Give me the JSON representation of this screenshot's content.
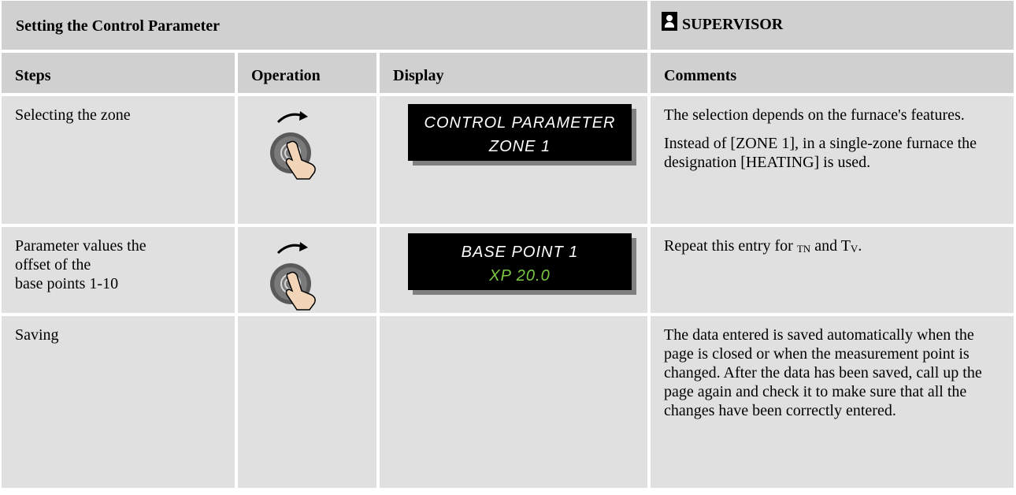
{
  "header": {
    "title": "Setting the Control Parameter",
    "role_label": "SUPERVISOR",
    "role_icon": "user-icon"
  },
  "columns": {
    "steps": "Steps",
    "operation": "Operation",
    "display": "Display",
    "comments": "Comments"
  },
  "rows": [
    {
      "step": "Selecting the zone",
      "operation_icon": "rotary-knob-icon",
      "display": {
        "line1": "CONTROL PARAMETER",
        "line2": "ZONE 1"
      },
      "comments": [
        "The selection depends on the furnace's features.",
        "Instead of [ZONE 1], in a single-zone furnace the designation [HEATING] is used."
      ]
    },
    {
      "step_lines": [
        "Parameter values the",
        "offset of the",
        "base points 1-10"
      ],
      "operation_icon": "rotary-knob-icon",
      "display": {
        "line1": "BASE POINT 1",
        "line2": "XP 20.0"
      },
      "comment_prefix": "Repeat this entry for ",
      "comment_sub1": "TN",
      "comment_mid": " and T",
      "comment_sub2": "V",
      "comment_suffix": "."
    },
    {
      "step": "Saving",
      "comments": [
        "The data entered is saved automatically when the page is closed or when the measurement point is changed. After the data has been saved, call up the page again and check it to make sure that all the changes have been correctly entered."
      ]
    }
  ],
  "colors": {
    "header_bg": "#d0d0d0",
    "cell_bg": "#e0e0e0",
    "lcd_bg": "#000000",
    "lcd_text": "#ffffff",
    "lcd_value": "#7ac943"
  }
}
